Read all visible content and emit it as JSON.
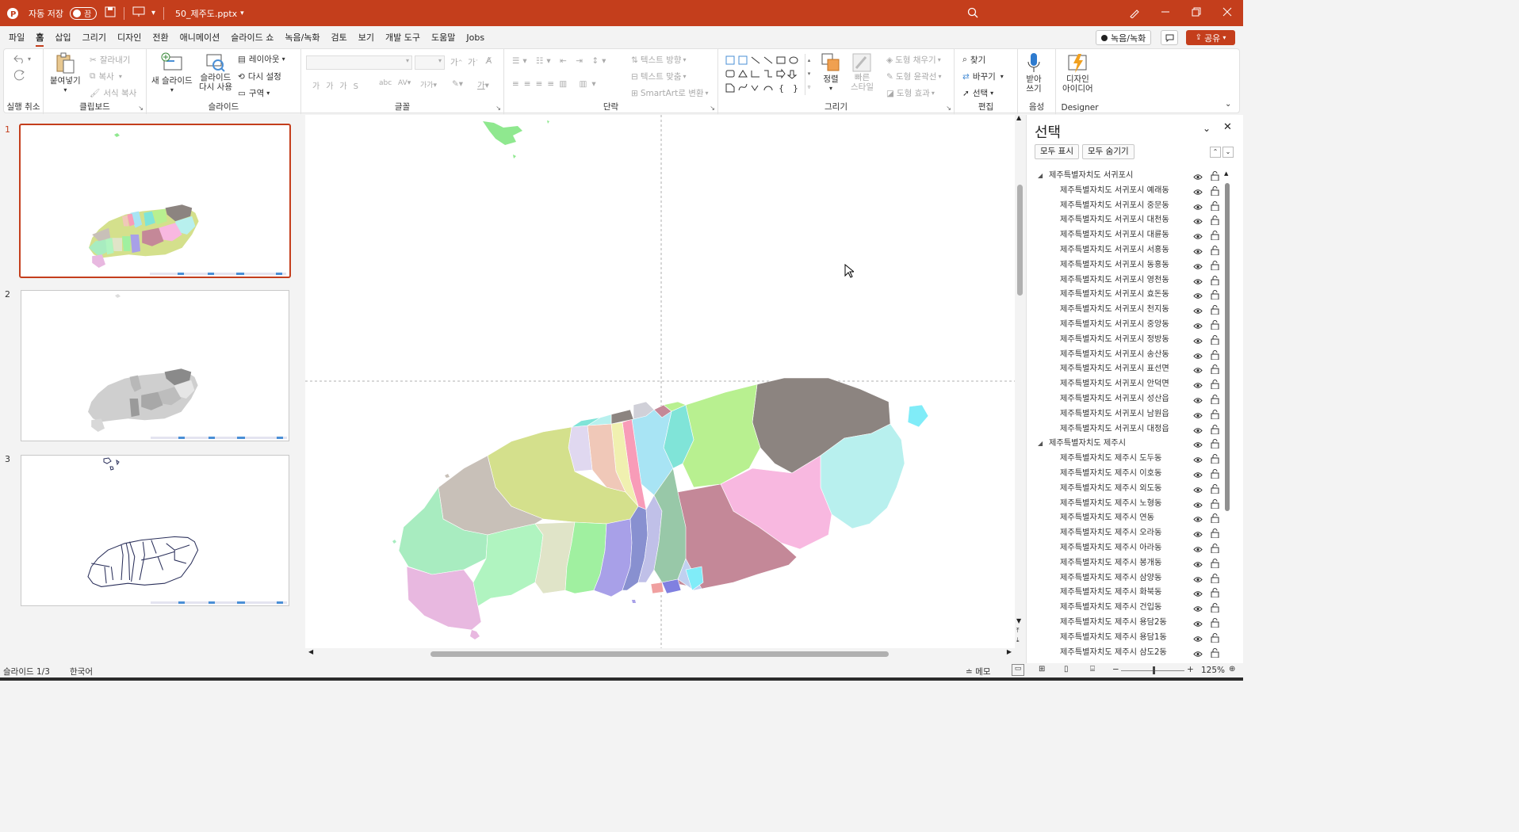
{
  "titlebar": {
    "autosave_label": "자동 저장",
    "autosave_state": "끔",
    "filename": "50_제주도.pptx",
    "bg_color": "#c43e1c"
  },
  "menubar": {
    "items": [
      "파일",
      "홈",
      "삽입",
      "그리기",
      "디자인",
      "전환",
      "애니메이션",
      "슬라이드 쇼",
      "녹음/녹화",
      "검토",
      "보기",
      "개발 도구",
      "도움말",
      "Jobs"
    ],
    "active_index": 1,
    "record_label": "녹음/녹화",
    "share_label": "공유"
  },
  "ribbon": {
    "undo_group": "실행 취소",
    "clipboard": {
      "label": "클립보드",
      "paste": "붙여넣기",
      "cut": "잘라내기",
      "copy": "복사",
      "format_painter": "서식 복사"
    },
    "slides": {
      "label": "슬라이드",
      "new_slide": "새 슬라이드",
      "reuse_line1": "슬라이드",
      "reuse_line2": "다시 사용",
      "layout": "레이아웃",
      "reset": "다시 설정",
      "section": "구역"
    },
    "font": {
      "label": "글꼴"
    },
    "paragraph": {
      "label": "단락",
      "text_direction": "텍스트 방향",
      "align_text": "텍스트 맞춤",
      "smartart": "SmartArt로 변환"
    },
    "drawing": {
      "label": "그리기",
      "arrange": "정렬",
      "quick_styles_1": "빠른",
      "quick_styles_2": "스타일",
      "shape_fill": "도형 채우기",
      "shape_outline": "도형 윤곽선",
      "shape_effects": "도형 효과"
    },
    "editing": {
      "label": "편집",
      "find": "찾기",
      "replace": "바꾸기",
      "select": "선택"
    },
    "voice": {
      "label": "음성",
      "dictate_1": "받아",
      "dictate_2": "쓰기"
    },
    "designer": {
      "label": "Designer",
      "ideas_1": "디자인",
      "ideas_2": "아이디어"
    }
  },
  "thumbnails": {
    "numbers": [
      "1",
      "2",
      "3"
    ],
    "selected": 0
  },
  "selection_pane": {
    "title": "선택",
    "show_all": "모두 표시",
    "hide_all": "모두 숨기기",
    "groups": [
      {
        "name": "제주특별자치도 서귀포시",
        "items": [
          "제주특별자치도 서귀포시 예래동",
          "제주특별자치도 서귀포시 중문동",
          "제주특별자치도 서귀포시 대천동",
          "제주특별자치도 서귀포시 대륜동",
          "제주특별자치도 서귀포시 서홍동",
          "제주특별자치도 서귀포시 동홍동",
          "제주특별자치도 서귀포시 영천동",
          "제주특별자치도 서귀포시 효돈동",
          "제주특별자치도 서귀포시 천지동",
          "제주특별자치도 서귀포시 중앙동",
          "제주특별자치도 서귀포시 정방동",
          "제주특별자치도 서귀포시 송산동",
          "제주특별자치도 서귀포시 표선면",
          "제주특별자치도 서귀포시 안덕면",
          "제주특별자치도 서귀포시 성산읍",
          "제주특별자치도 서귀포시 남원읍",
          "제주특별자치도 서귀포시 대정읍"
        ]
      },
      {
        "name": "제주특별자치도 제주시",
        "items": [
          "제주특별자치도 제주시 도두동",
          "제주특별자치도 제주시 이호동",
          "제주특별자치도 제주시 외도동",
          "제주특별자치도 제주시 노형동",
          "제주특별자치도 제주시 연동",
          "제주특별자치도 제주시 오라동",
          "제주특별자치도 제주시 아라동",
          "제주특별자치도 제주시 봉개동",
          "제주특별자치도 제주시 삼양동",
          "제주특별자치도 제주시 화북동",
          "제주특별자치도 제주시 건입동",
          "제주특별자치도 제주시 용담2동",
          "제주특별자치도 제주시 용담1동",
          "제주특별자치도 제주시 삼도2동"
        ]
      }
    ]
  },
  "statusbar": {
    "slide": "슬라이드 1/3",
    "language": "한국어",
    "notes": "메모",
    "zoom": "125%"
  },
  "map_colors": [
    "#8c8480",
    "#b8f0ee",
    "#f8b8e0",
    "#c48898",
    "#d4e08c",
    "#c8c0b8",
    "#a8ecc0",
    "#e8b8e0",
    "#b0f4c0",
    "#f0c8b8",
    "#f89cb8",
    "#a8e4f4",
    "#80e4d8",
    "#b8f090",
    "#a8a0e8",
    "#8890d0",
    "#98c8a8",
    "#e0e4c8",
    "#80ecf8",
    "#a0f0a0"
  ]
}
